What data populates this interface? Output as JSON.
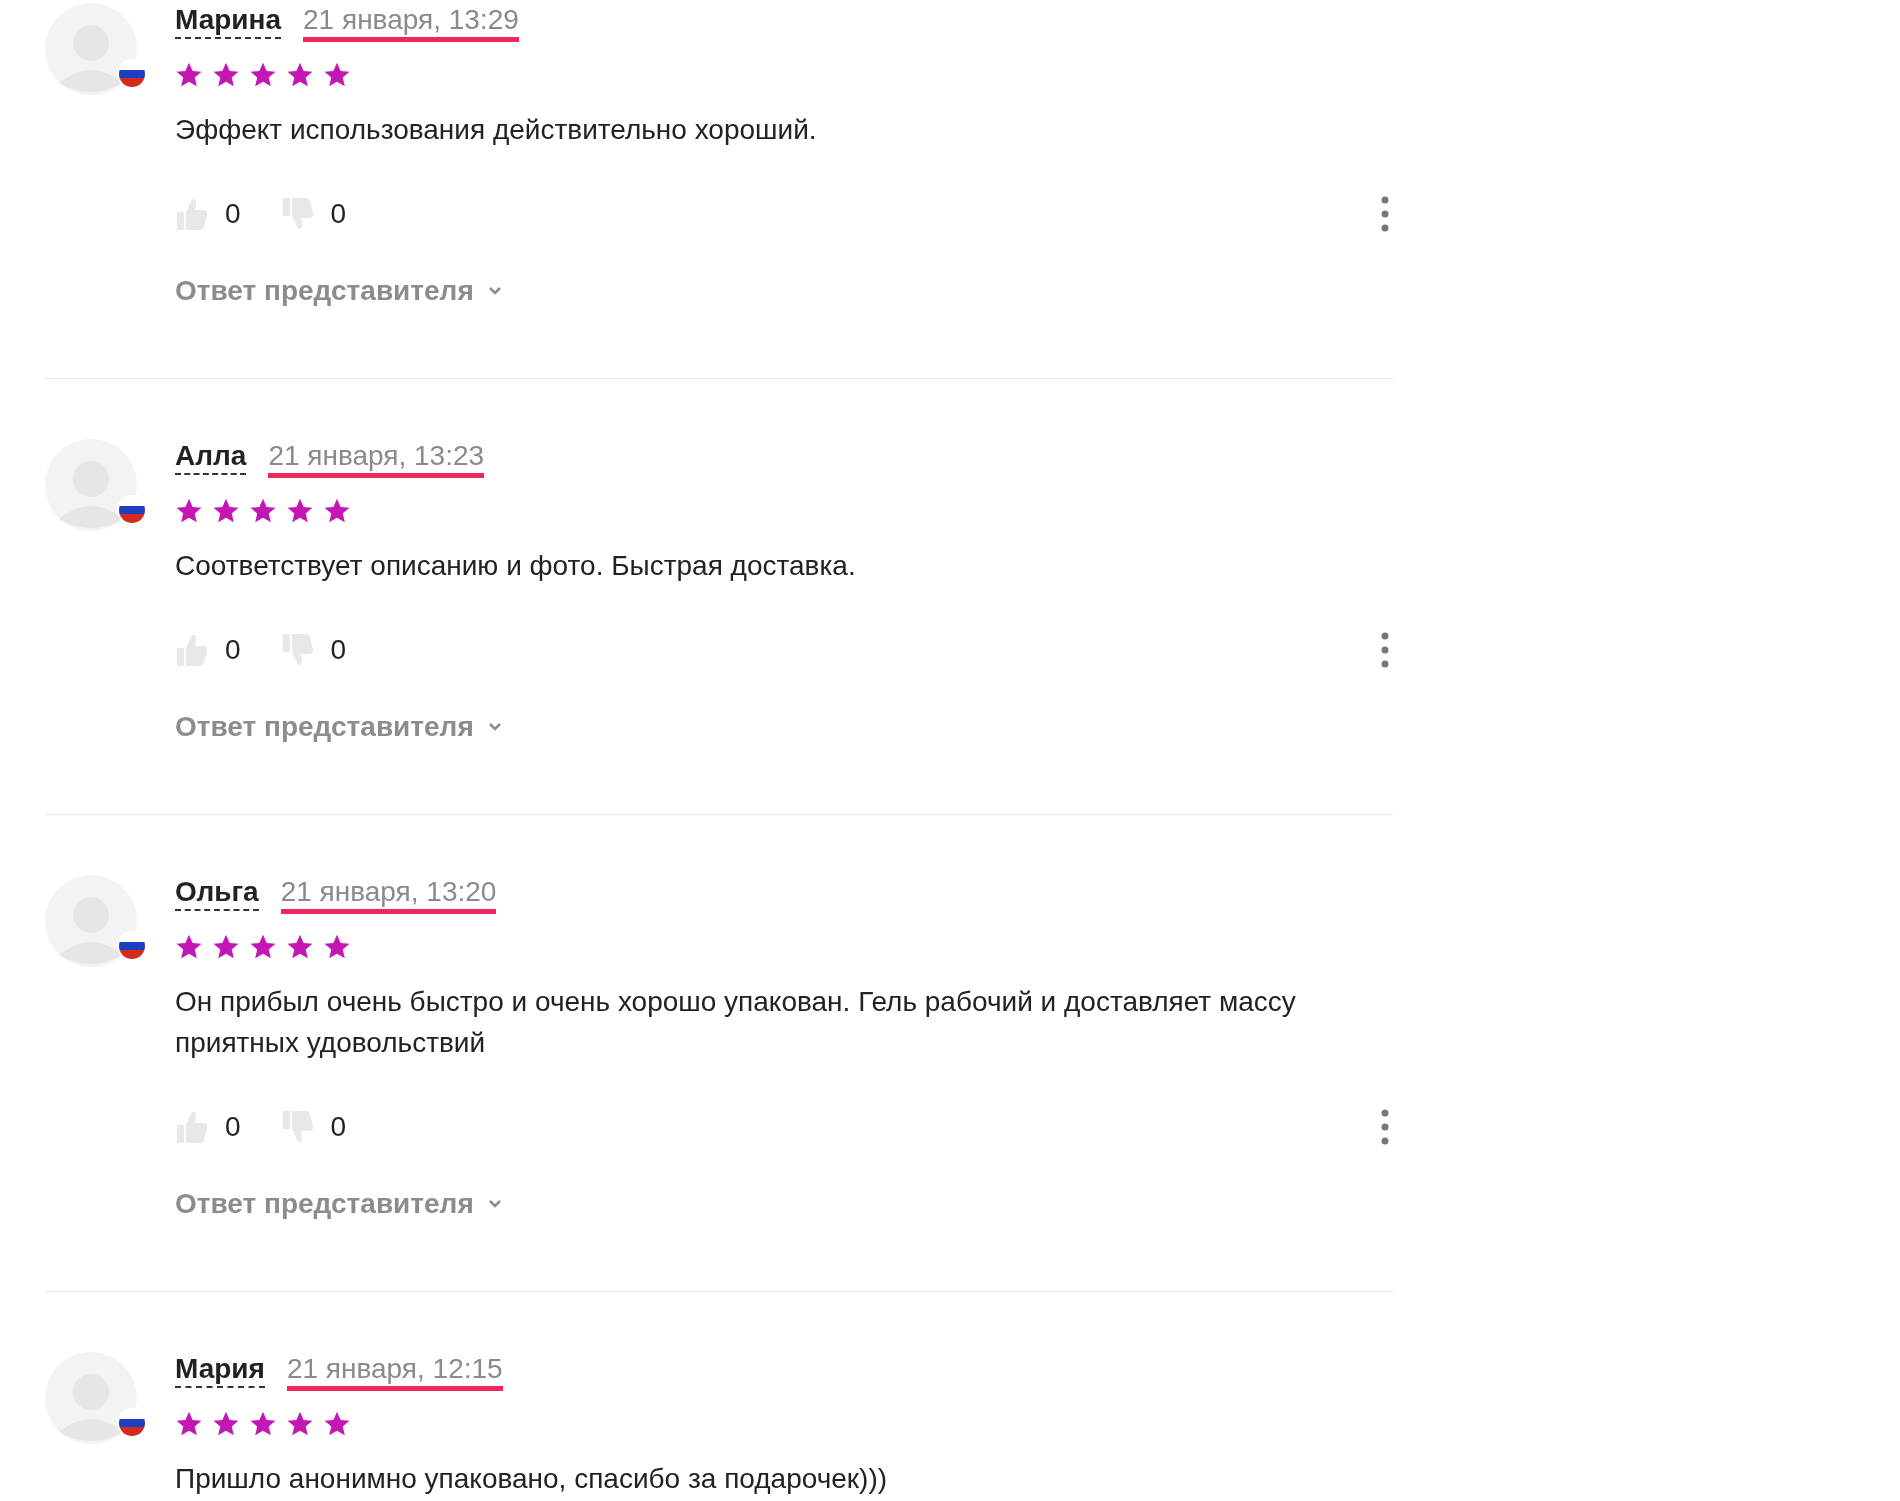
{
  "reviews": [
    {
      "author": "Марина",
      "date": "21 января, 13:29",
      "stars": 5,
      "text": "Эффект использования действительно хороший.",
      "likes": "0",
      "dislikes": "0",
      "reply_link": "Ответ представителя"
    },
    {
      "author": "Алла",
      "date": "21 января, 13:23",
      "stars": 5,
      "text": "Соответствует описанию и фото. Быстрая доставка.",
      "likes": "0",
      "dislikes": "0",
      "reply_link": "Ответ представителя"
    },
    {
      "author": "Ольга",
      "date": "21 января, 13:20",
      "stars": 5,
      "text": "Он прибыл очень быстро и очень хорошо упакован. Гель рабочий и доставляет массу приятных удовольствий",
      "likes": "0",
      "dislikes": "0",
      "reply_link": "Ответ представителя"
    },
    {
      "author": "Мария",
      "date": "21 января, 12:15",
      "stars": 5,
      "text": "Пришло анонимно упаковано, спасибо за подарочек)))"
    }
  ]
}
